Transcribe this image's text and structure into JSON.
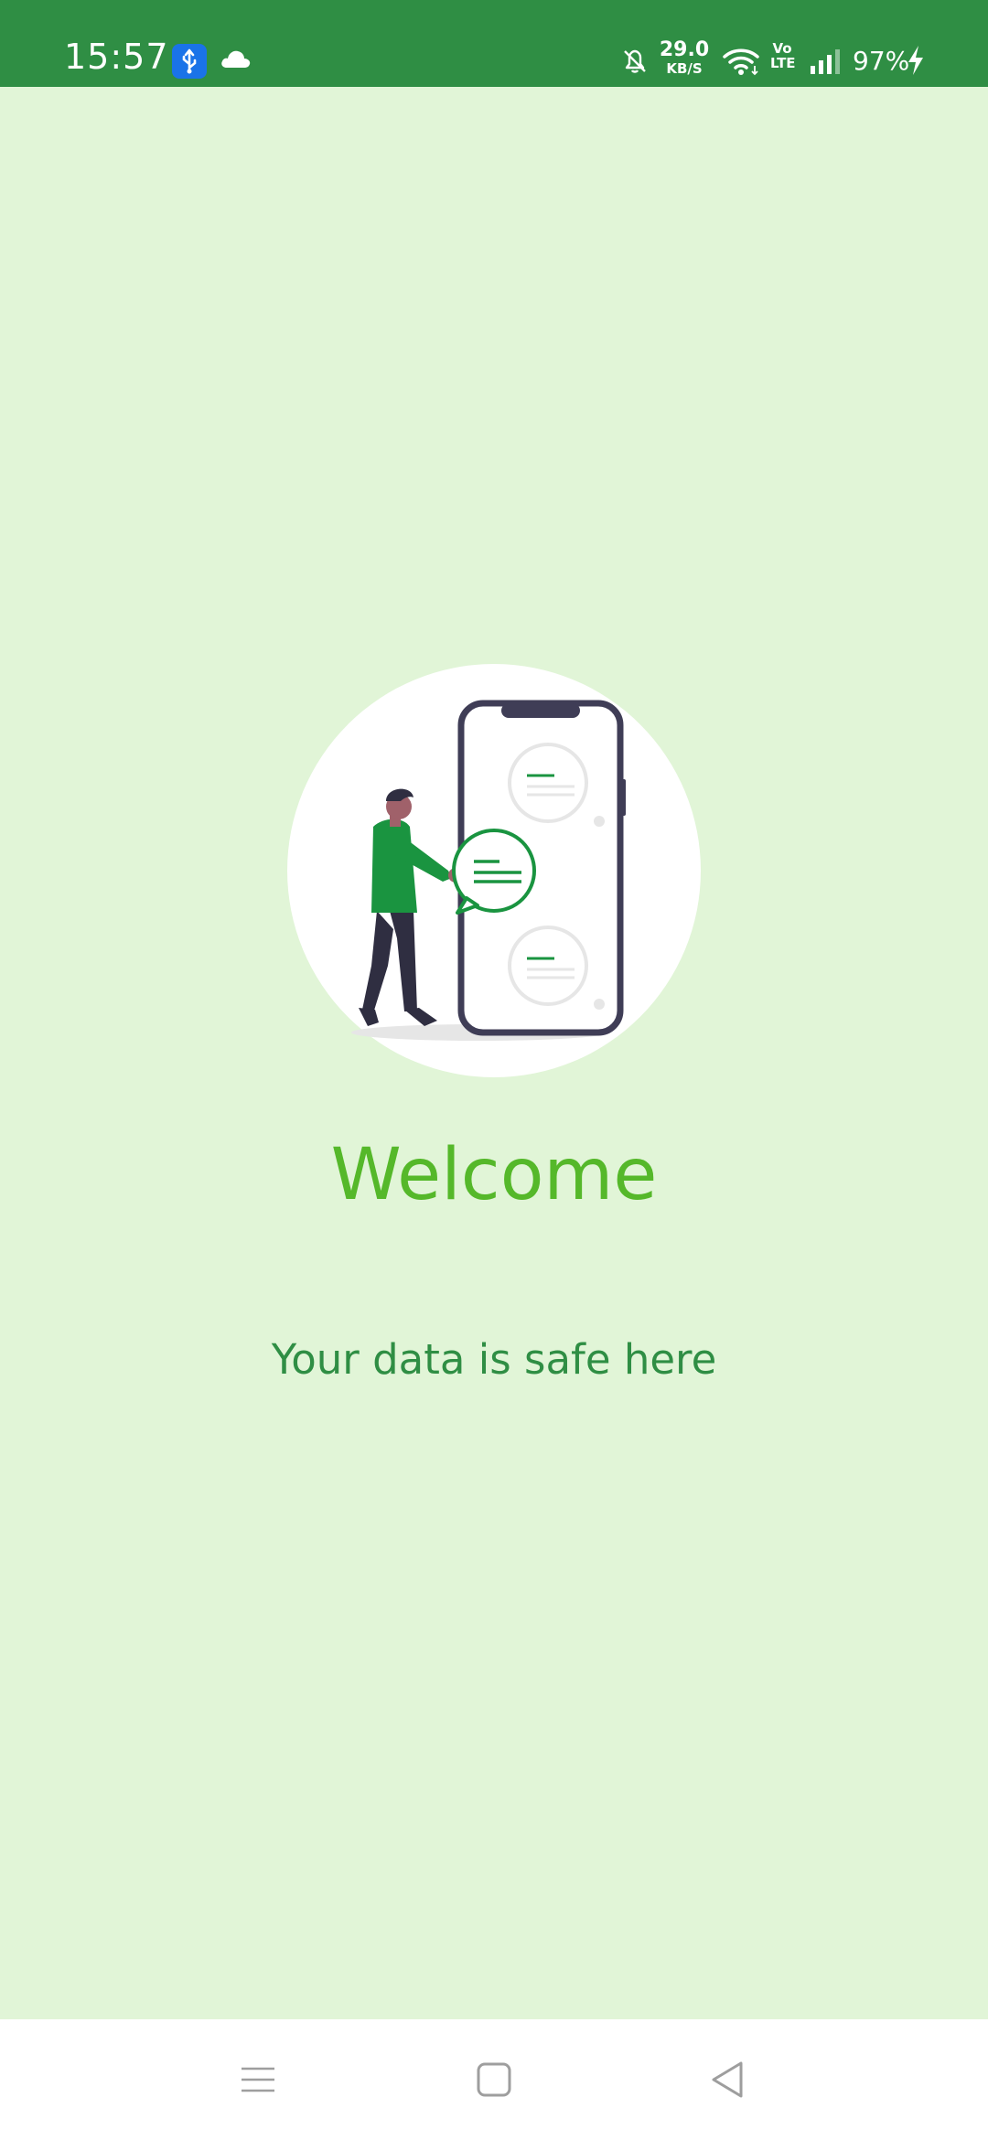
{
  "status_bar": {
    "time": "15:57",
    "net_speed_value": "29.0",
    "net_speed_unit": "KB/S",
    "volte_top": "Vo",
    "volte_bottom": "LTE",
    "battery": "97%",
    "icons": [
      "usb-icon",
      "cloud-icon",
      "bell-off-icon",
      "wifi-icon",
      "volte-icon",
      "signal-icon",
      "charging-bolt-icon"
    ]
  },
  "main": {
    "title": "Welcome",
    "subtitle": "Your data is safe here"
  },
  "nav_bar": {
    "icons": [
      "menu-icon",
      "home-icon",
      "back-icon"
    ]
  },
  "colors": {
    "status_bar": "#2f8e44",
    "background": "#e1f5d7",
    "title": "#55b82a",
    "subtitle": "#2f8e44",
    "accent_green": "#1a9440",
    "phone_frame": "#3f3d56"
  }
}
